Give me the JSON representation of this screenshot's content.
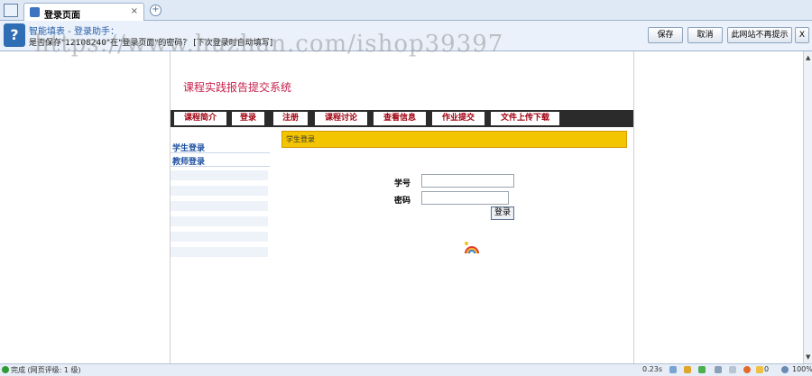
{
  "browser": {
    "tab_title": "登录页面",
    "tab_close": "×",
    "new_tab": "+"
  },
  "notification": {
    "icon_glyph": "?",
    "title": "智能填表 - 登录助手：",
    "message": "是否保存\"12108240\"在\"登录页面\"的密码？ [下次登录时自动填写]",
    "buttons": {
      "save": "保存",
      "cancel": "取消",
      "never": "此网站不再提示",
      "close": "X"
    }
  },
  "watermark": "https://www.huzhan.com/ishop39397",
  "site": {
    "title": "课程实践报告提交系统",
    "nav": [
      "课程简介",
      "登录",
      "注册",
      "课程讨论",
      "查看信息",
      "作业提交",
      "文件上传下载"
    ],
    "sidebar": [
      "学生登录",
      "教师登录"
    ]
  },
  "login": {
    "panel_title": "学生登录",
    "id_label": "学号",
    "password_label": "密码",
    "submit": "登录"
  },
  "status": {
    "done": "完成 (网页评级: 1 级)",
    "time": "0.23s",
    "count": "0",
    "zoom": "100%"
  },
  "colors": {
    "nav_bg": "#2b2b2b",
    "nav_text": "#a00010",
    "title_color": "#c81f4a",
    "panel_bg": "#f3c400"
  }
}
